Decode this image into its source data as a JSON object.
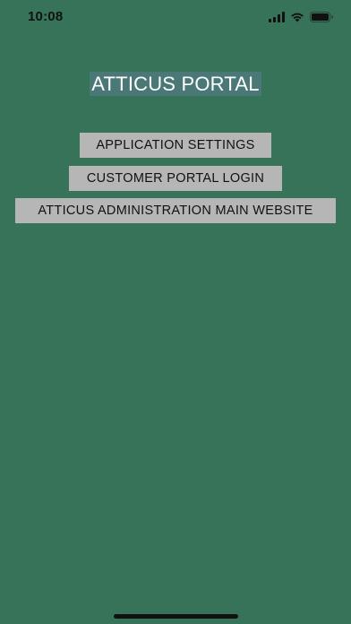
{
  "status_bar": {
    "time": "10:08",
    "icons": [
      "signal-icon",
      "wifi-icon",
      "battery-icon"
    ]
  },
  "header": {
    "title": "ATTICUS PORTAL"
  },
  "menu": {
    "application_settings": "APPLICATION SETTINGS",
    "customer_portal_login": "CUSTOMER PORTAL LOGIN",
    "main_website": "ATTICUS ADMINISTRATION MAIN WEBSITE"
  },
  "colors": {
    "background": "#367359",
    "title_background": "#4a7876",
    "button_background": "#b6b6b6"
  }
}
